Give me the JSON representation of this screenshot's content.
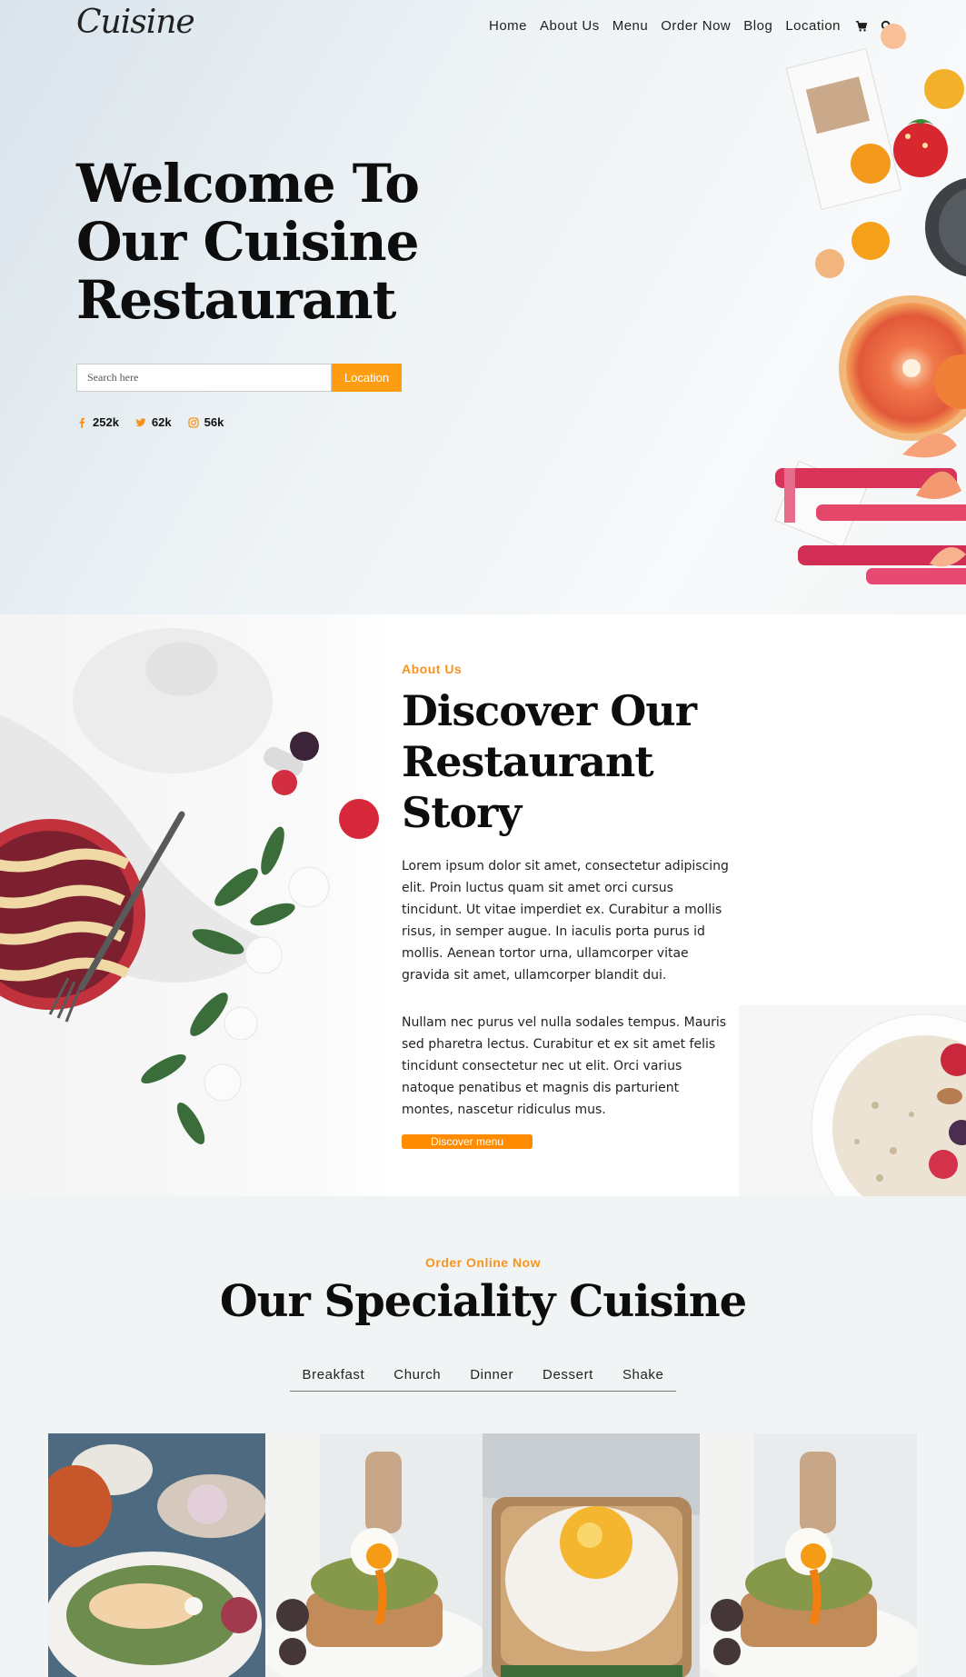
{
  "header": {
    "logo": "Cuisine",
    "nav": [
      "Home",
      "About Us",
      "Menu",
      "Order Now",
      "Blog",
      "Location"
    ],
    "icons": [
      "cart-icon",
      "search-icon"
    ]
  },
  "hero": {
    "title": "Welcome To Our Cuisine Restaurant",
    "search_placeholder": "Search here",
    "location_button": "Location",
    "socials": [
      {
        "icon": "facebook-icon",
        "count": "252k"
      },
      {
        "icon": "twitter-icon",
        "count": "62k"
      },
      {
        "icon": "instagram-icon",
        "count": "56k"
      }
    ]
  },
  "about": {
    "eyebrow": "About Us",
    "title": "Discover Our Restaurant Story",
    "para1": "Lorem ipsum dolor sit amet, consectetur adipiscing elit. Proin luctus quam sit amet orci cursus tincidunt. Ut vitae imperdiet ex. Curabitur a mollis risus, in semper augue. In iaculis porta purus id mollis. Aenean tortor urna, ullamcorper vitae gravida sit amet, ullamcorper blandit dui.",
    "para2": "Nullam nec purus vel nulla sodales tempus. Mauris sed pharetra lectus. Curabitur et ex sit amet felis tincidunt consectetur nec ut elit. Orci varius natoque penatibus et magnis dis parturient montes, nascetur ridiculus mus.",
    "button": "Discover menu"
  },
  "speciality": {
    "eyebrow": "Order Online Now",
    "title": "Our Speciality Cuisine",
    "tabs": [
      "Breakfast",
      "Church",
      "Dinner",
      "Dessert",
      "Shake"
    ]
  },
  "colors": {
    "accent": "#f7931e",
    "button": "#ff9d12"
  }
}
